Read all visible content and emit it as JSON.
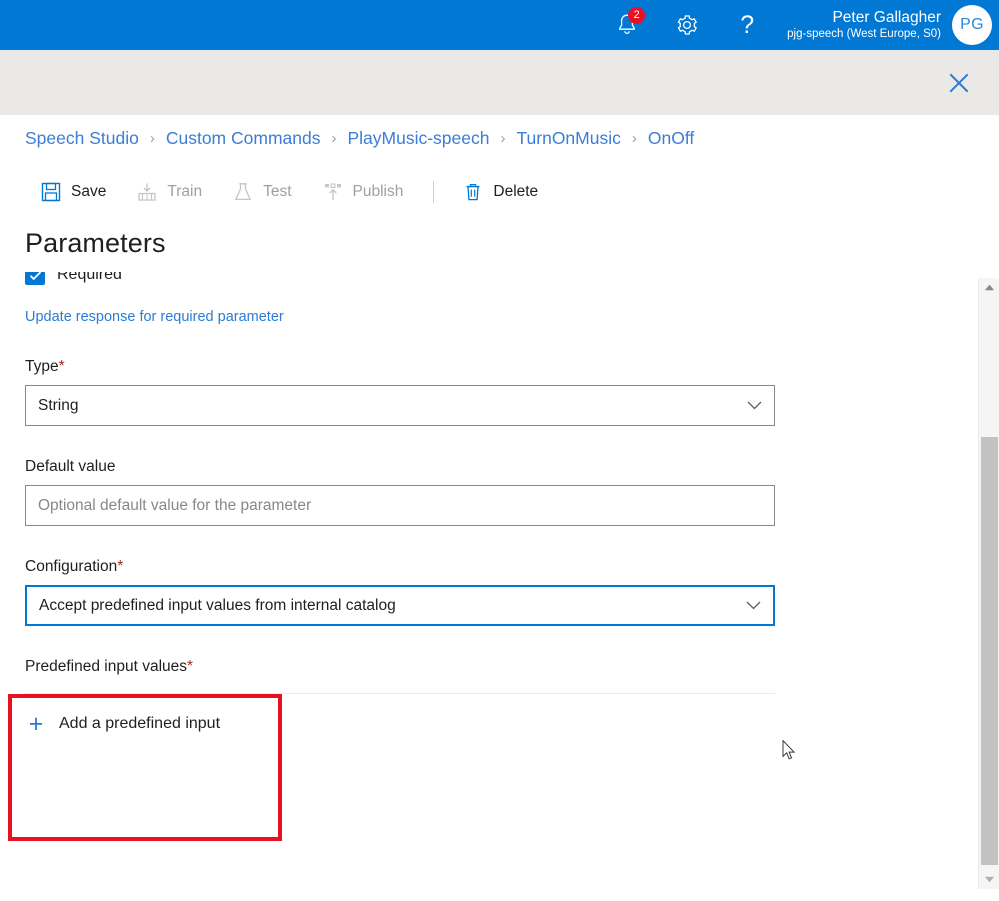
{
  "topbar": {
    "notifications": {
      "icon": "bell-icon",
      "badge_count": "2"
    },
    "settings": {
      "icon": "gear-icon"
    },
    "help": {
      "icon": "help-icon",
      "glyph": "?"
    },
    "user": {
      "name": "Peter Gallagher",
      "subscription": "pjg-speech (West Europe, S0)",
      "initials": "PG"
    },
    "accent_color": "#0078d4"
  },
  "subbar": {
    "close_label": "Close",
    "close_icon": "close-icon",
    "background": "#eae9e8"
  },
  "breadcrumb": {
    "separator": "›",
    "items": [
      {
        "label": "Speech Studio"
      },
      {
        "label": "Custom Commands"
      },
      {
        "label": "PlayMusic-speech"
      },
      {
        "label": "TurnOnMusic"
      },
      {
        "label": "OnOff"
      }
    ],
    "link_color": "#3b7dd8"
  },
  "toolbar": {
    "commands": [
      {
        "label": "Save",
        "icon": "save-icon",
        "enabled": true
      },
      {
        "label": "Train",
        "icon": "train-icon",
        "enabled": false
      },
      {
        "label": "Test",
        "icon": "test-flask-icon",
        "enabled": false
      },
      {
        "label": "Publish",
        "icon": "publish-icon",
        "enabled": false
      }
    ],
    "delete": {
      "label": "Delete",
      "icon": "trash-icon",
      "enabled": true
    }
  },
  "page": {
    "title": "Parameters"
  },
  "form": {
    "required_checkbox": {
      "label": "Required",
      "checked": true,
      "icon": "checkmark-icon"
    },
    "update_response_link": "Update response for required parameter",
    "type_field": {
      "label": "Type",
      "required_marker": "*",
      "value": "String",
      "chevron": "chevron-down-icon"
    },
    "default_value_field": {
      "label": "Default value",
      "value": "",
      "placeholder": "Optional default value for the parameter"
    },
    "configuration_field": {
      "label": "Configuration",
      "required_marker": "*",
      "value": "Accept predefined input values from internal catalog",
      "chevron": "chevron-down-icon",
      "focused": true
    },
    "predefined_input_values": {
      "label": "Predefined input values",
      "required_marker": "*",
      "add_label": "Add a predefined input",
      "add_icon": "plus-icon",
      "items": []
    }
  },
  "annotation": {
    "highlight_color": "#e81123"
  },
  "scrollbar": {
    "up_arrow": "chevron-up-icon",
    "down_arrow": "chevron-down-icon"
  }
}
